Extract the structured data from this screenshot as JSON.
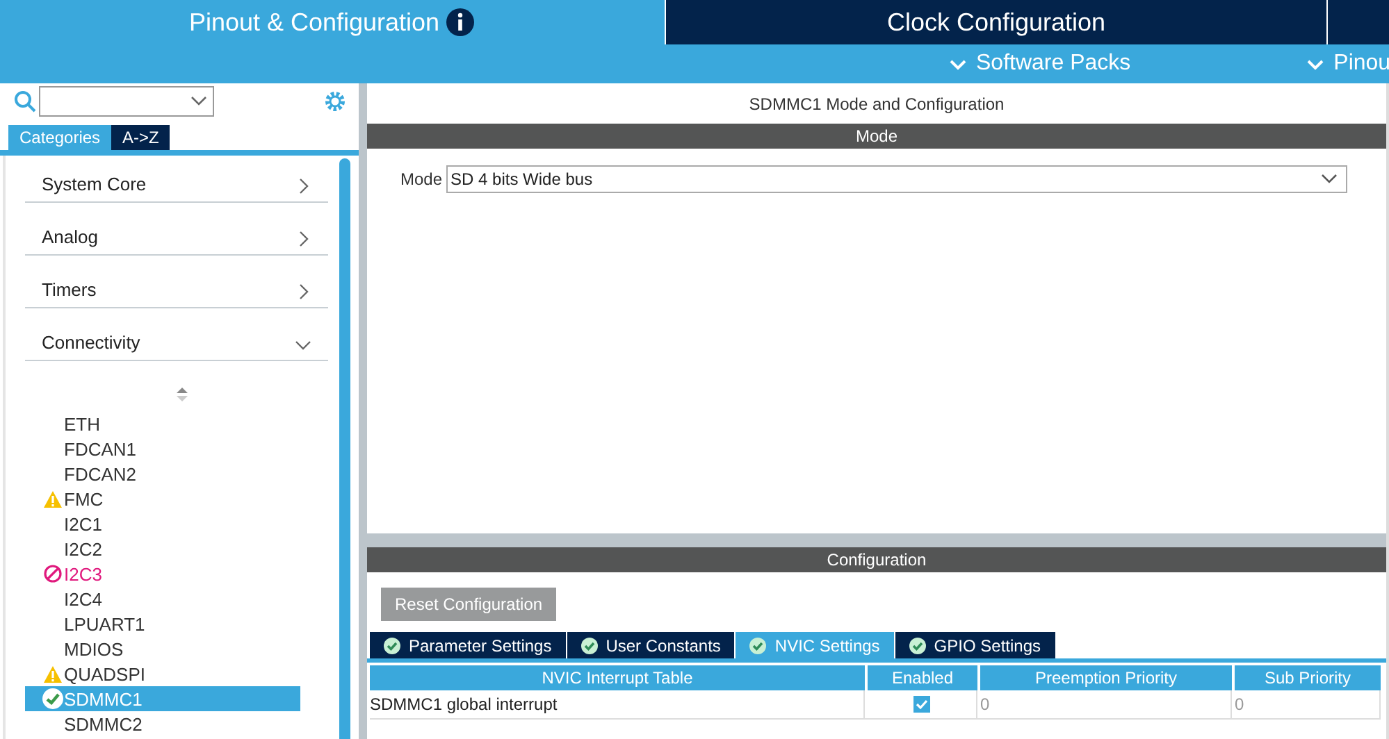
{
  "top_tabs": [
    {
      "label": "Pinout & Configuration",
      "selected": true,
      "info": true
    },
    {
      "label": "Clock Configuration",
      "selected": false,
      "info": false
    },
    {
      "selected": false,
      "info": false
    }
  ],
  "sub_menu": [
    {
      "label": "Software Packs"
    },
    {
      "label": "Pinou"
    }
  ],
  "sidebar": {
    "list_tabs": [
      {
        "label": "Categories",
        "selected": true
      },
      {
        "label": "A->Z",
        "selected": false
      }
    ],
    "categories": [
      {
        "label": "System Core",
        "expanded": false
      },
      {
        "label": "Analog",
        "expanded": false
      },
      {
        "label": "Timers",
        "expanded": false
      },
      {
        "label": "Connectivity",
        "expanded": true
      }
    ],
    "items": [
      {
        "label": "ETH",
        "kind": "plain",
        "selected": false
      },
      {
        "label": "FDCAN1",
        "kind": "plain",
        "selected": false
      },
      {
        "label": "FDCAN2",
        "kind": "plain",
        "selected": false
      },
      {
        "label": "FMC",
        "kind": "warning",
        "selected": false
      },
      {
        "label": "I2C1",
        "kind": "plain",
        "selected": false
      },
      {
        "label": "I2C2",
        "kind": "plain",
        "selected": false
      },
      {
        "label": "I2C3",
        "kind": "error",
        "selected": false
      },
      {
        "label": "I2C4",
        "kind": "plain",
        "selected": false
      },
      {
        "label": "LPUART1",
        "kind": "plain",
        "selected": false
      },
      {
        "label": "MDIOS",
        "kind": "plain",
        "selected": false
      },
      {
        "label": "QUADSPI",
        "kind": "warning",
        "selected": false
      },
      {
        "label": "SDMMC1",
        "kind": "ok",
        "selected": true
      },
      {
        "label": "SDMMC2",
        "kind": "plain",
        "selected": false
      }
    ]
  },
  "panel": {
    "title": "SDMMC1 Mode and Configuration",
    "mode_header": "Mode",
    "mode_label": "Mode",
    "mode_value": "SD 4 bits Wide bus",
    "config_header": "Configuration",
    "reset_button": "Reset Configuration",
    "config_tabs": [
      {
        "label": "Parameter Settings",
        "selected": false
      },
      {
        "label": "User Constants",
        "selected": false
      },
      {
        "label": "NVIC Settings",
        "selected": true
      },
      {
        "label": "GPIO Settings",
        "selected": false
      }
    ],
    "table": {
      "columns": [
        "NVIC Interrupt Table",
        "Enabled",
        "Preemption Priority",
        "Sub Priority"
      ],
      "rows": [
        {
          "name": "SDMMC1 global interrupt",
          "enabled": true,
          "preemption": "0",
          "sub": "0"
        }
      ]
    }
  }
}
